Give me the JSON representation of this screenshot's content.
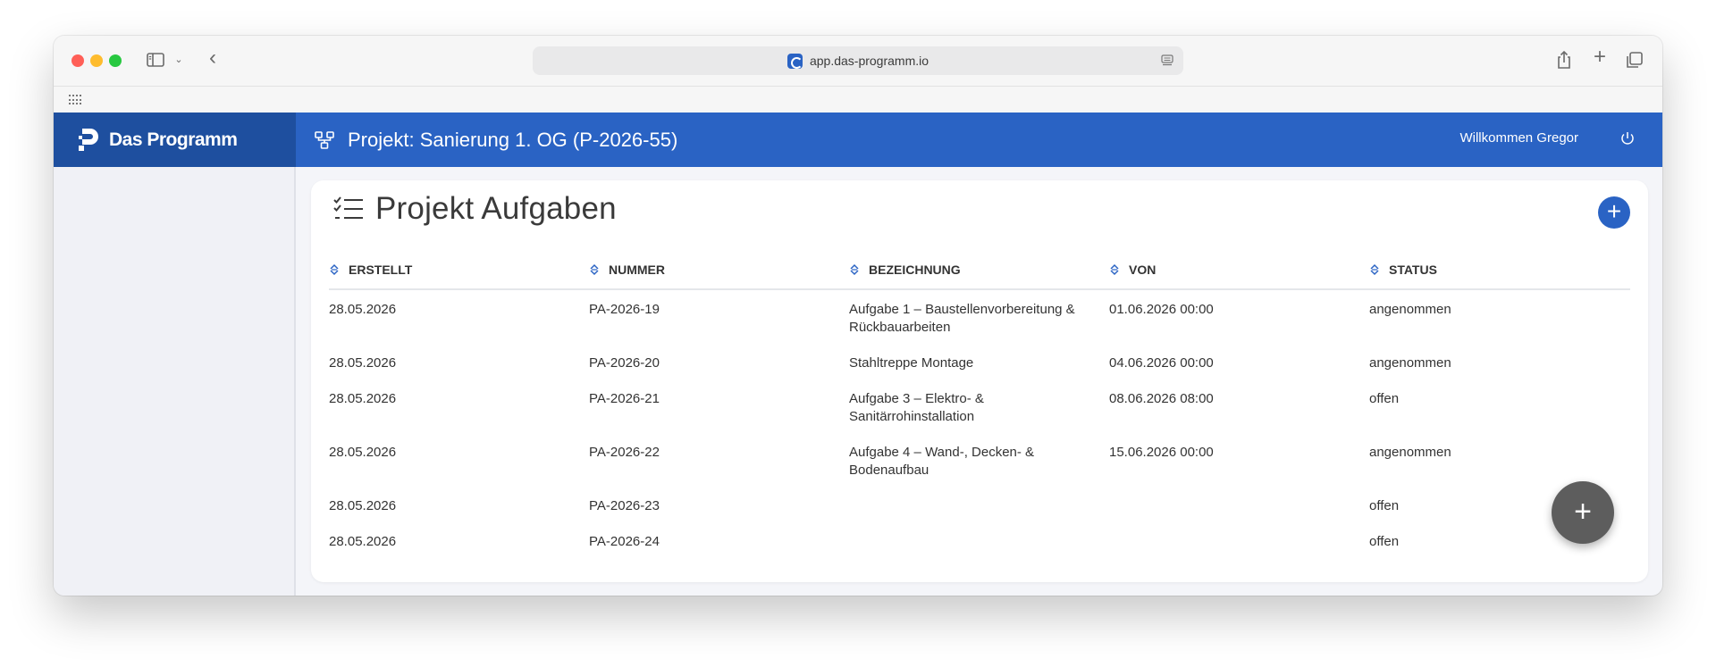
{
  "browser": {
    "url": "app.das-programm.io"
  },
  "app": {
    "brand_name": "Das Programm",
    "project_title": "Projekt: Sanierung 1. OG (P-2026-55)",
    "welcome": "Willkommen Gregor"
  },
  "card": {
    "title": "Projekt Aufgaben"
  },
  "table": {
    "headers": [
      "ERSTELLT",
      "NUMMER",
      "BEZEICHNUNG",
      "VON",
      "STATUS"
    ],
    "rows": [
      {
        "erstellt": "28.05.2026",
        "nummer": "PA-2026-19",
        "bezeichnung": "Aufgabe 1 – Baustellenvorbereitung & Rückbauarbeiten",
        "von": "01.06.2026 00:00",
        "status": "angenommen"
      },
      {
        "erstellt": "28.05.2026",
        "nummer": "PA-2026-20",
        "bezeichnung": "Stahltreppe Montage",
        "von": "04.06.2026 00:00",
        "status": "angenommen"
      },
      {
        "erstellt": "28.05.2026",
        "nummer": "PA-2026-21",
        "bezeichnung": "Aufgabe 3 – Elektro- & Sanitärrohinstallation",
        "von": "08.06.2026 08:00",
        "status": "offen"
      },
      {
        "erstellt": "28.05.2026",
        "nummer": "PA-2026-22",
        "bezeichnung": "Aufgabe 4 – Wand-, Decken- & Bodenaufbau",
        "von": "15.06.2026 00:00",
        "status": "angenommen"
      },
      {
        "erstellt": "28.05.2026",
        "nummer": "PA-2026-23",
        "bezeichnung": "",
        "von": "",
        "status": "offen"
      },
      {
        "erstellt": "28.05.2026",
        "nummer": "PA-2026-24",
        "bezeichnung": "",
        "von": "",
        "status": "offen"
      }
    ]
  },
  "colors": {
    "brand_dark": "#1e4f9f",
    "header_blue": "#2a63c4",
    "link_blue": "#2a63c4",
    "fab_gray": "#5d5d5d"
  }
}
